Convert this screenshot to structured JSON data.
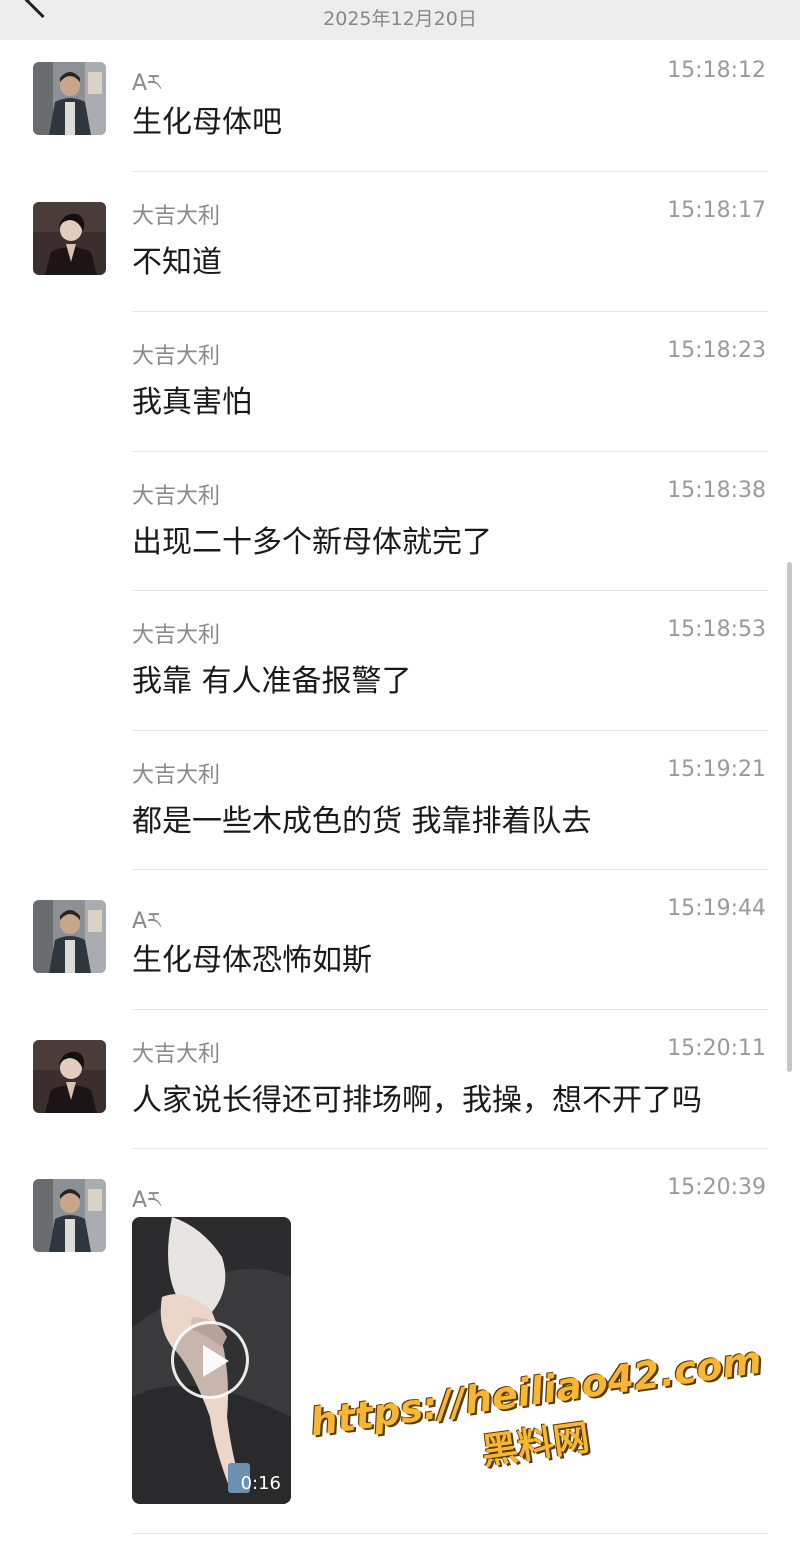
{
  "header": {
    "date": "2025年12月20日"
  },
  "messages": [
    {
      "sender": "Aཪ",
      "time": "15:18:12",
      "text": "生化母体吧",
      "avatar": "avatar-a"
    },
    {
      "sender": "大吉大利",
      "time": "15:18:17",
      "text": "不知道",
      "avatar": "avatar-b"
    },
    {
      "sender": "大吉大利",
      "time": "15:18:23",
      "text": "我真害怕"
    },
    {
      "sender": "大吉大利",
      "time": "15:18:38",
      "text": "出现二十多个新母体就完了"
    },
    {
      "sender": "大吉大利",
      "time": "15:18:53",
      "text": "我靠 有人准备报警了"
    },
    {
      "sender": "大吉大利",
      "time": "15:19:21",
      "text": "都是一些木成色的货 我靠排着队去"
    },
    {
      "sender": "Aཪ",
      "time": "15:19:44",
      "text": "生化母体恐怖如斯",
      "avatar": "avatar-a"
    },
    {
      "sender": "大吉大利",
      "time": "15:20:11",
      "text": "人家说长得还可排场啊，我操，想不开了吗",
      "avatar": "avatar-b"
    },
    {
      "sender": "Aཪ",
      "time": "15:20:39",
      "video_duration": "0:16",
      "avatar": "avatar-a"
    }
  ],
  "watermark": {
    "url": "https://heiliao42.com",
    "name": "黑料网"
  }
}
